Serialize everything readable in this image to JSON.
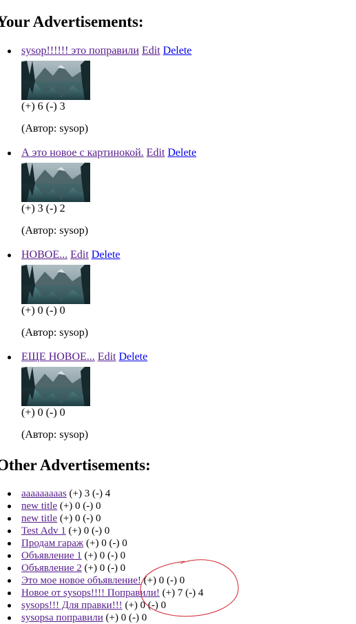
{
  "sections": {
    "your_title": "Your Advertisements:",
    "other_title": "Other Advertisements:"
  },
  "your_ads": [
    {
      "title": "sysop!!!!!! это поправили",
      "edit": "Edit",
      "delete": "Delete",
      "votes": "(+) 6 (-) 3",
      "author": "(Автор: sysop)"
    },
    {
      "title": "А это новое с картинокой.",
      "edit": "Edit",
      "delete": "Delete",
      "votes": "(+) 3 (-) 2",
      "author": "(Автор: sysop)"
    },
    {
      "title": "НОВОЕ...",
      "edit": "Edit",
      "delete": "Delete",
      "votes": "(+) 0 (-) 0",
      "author": "(Автор: sysop)"
    },
    {
      "title": "ЕЩЕ НОВОЕ...",
      "edit": "Edit",
      "delete": "Delete",
      "votes": "(+) 0 (-) 0",
      "author": "(Автор: sysop)"
    }
  ],
  "other_ads": [
    {
      "title": "aaaaaaaaas",
      "votes": "(+) 3 (-) 4"
    },
    {
      "title": "new title",
      "votes": "(+) 0 (-) 0"
    },
    {
      "title": "new title",
      "votes": "(+) 0 (-) 0"
    },
    {
      "title": "Test Adv 1",
      "votes": "(+) 0 (-) 0"
    },
    {
      "title": "Продам гараж",
      "votes": "(+) 0 (-) 0"
    },
    {
      "title": "Объявление 1",
      "votes": "(+) 0 (-) 0"
    },
    {
      "title": "Объявление 2",
      "votes": "(+) 0 (-) 0"
    },
    {
      "title": "Это мое новое объявление!",
      "votes": "(+) 0 (-) 0"
    },
    {
      "title": "Новое от sysops!!!! Поправили!",
      "votes": "(+) 7 (-) 4"
    },
    {
      "title": "sysops!!! Для правки!!!",
      "votes": "(+) 0 (-) 0"
    },
    {
      "title": "sysopsa поправили",
      "votes": "(+) 0 (-) 0"
    }
  ],
  "colors": {
    "visited_link": "#551a8b",
    "unvisited_link": "#0000ee",
    "annotation": "#d0202a"
  },
  "icons": {
    "thumbnail": "mountain-lake-image",
    "annotation": "hand-drawn-circle"
  }
}
